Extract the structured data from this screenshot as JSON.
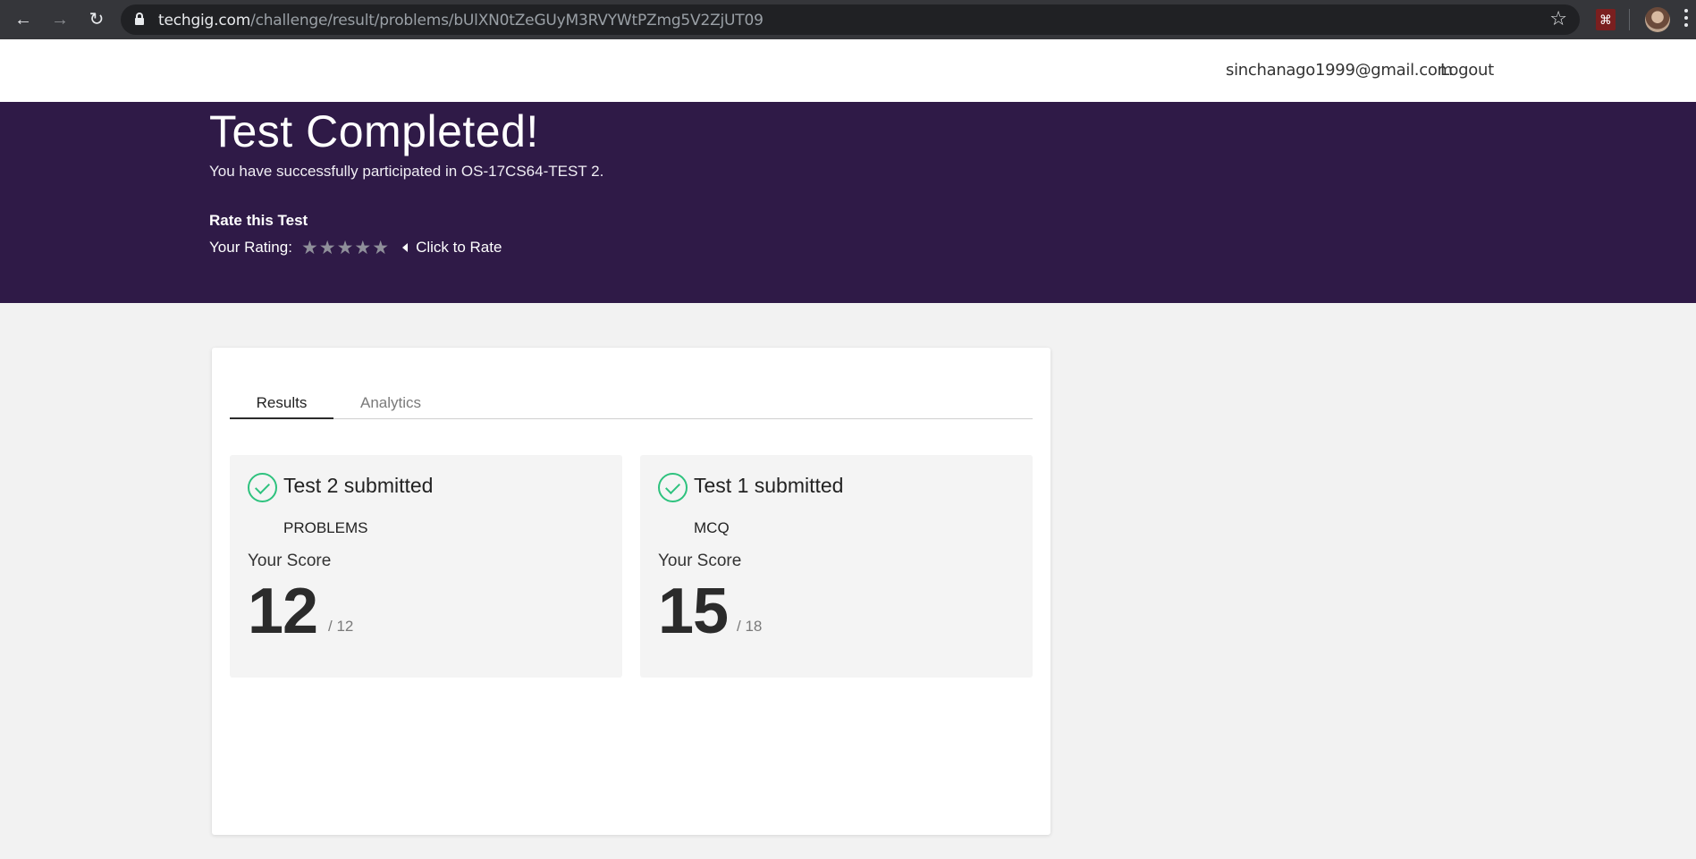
{
  "browser": {
    "url_host": "techgig.com",
    "url_path": "/challenge/result/problems/bUlXN0tZeGUyM3RVYWtPZmg5V2ZjUT09",
    "icons": [
      "back-icon",
      "forward-icon",
      "reload-icon",
      "lock-icon",
      "bookmark-star-icon",
      "pdf-extension-icon",
      "profile-avatar",
      "menu-icon"
    ]
  },
  "header": {
    "user_email": "sinchanago1999@gmail.com",
    "logout_label": "Logout"
  },
  "hero": {
    "title": "Test Completed!",
    "subtitle": "You have successfully participated in OS-17CS64-TEST 2.",
    "rate_heading": "Rate this Test",
    "rating_label": "Your Rating:",
    "rating_value": 0,
    "rating_max": 5,
    "click_to_rate": "Click to Rate"
  },
  "tabs": [
    {
      "label": "Results",
      "active": true
    },
    {
      "label": "Analytics",
      "active": false
    }
  ],
  "results": [
    {
      "title": "Test 2 submitted",
      "type": "PROBLEMS",
      "score_label": "Your Score",
      "score": "12",
      "max": "/ 12"
    },
    {
      "title": "Test 1 submitted",
      "type": "MCQ",
      "score_label": "Your Score",
      "score": "15",
      "max": "/ 18"
    }
  ],
  "colors": {
    "hero_bg": "#2f1a47",
    "check_green": "#2ec27e",
    "page_bg": "#f2f2f2"
  }
}
